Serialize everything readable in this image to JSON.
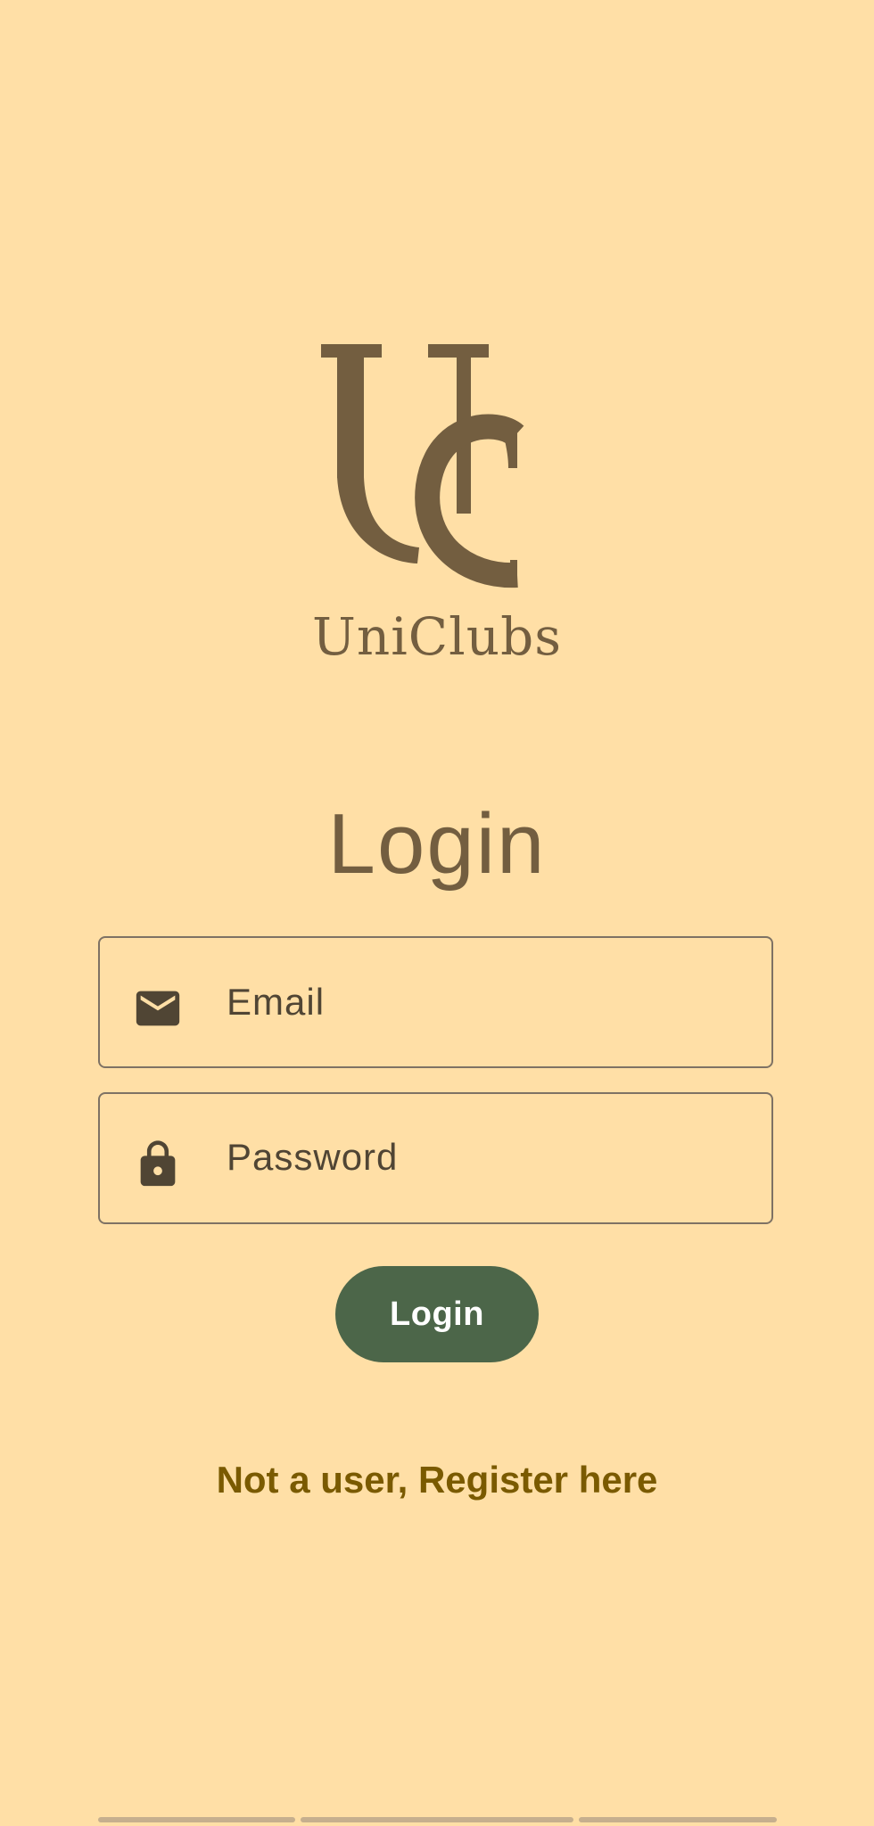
{
  "brand": {
    "name": "UniClubs",
    "logo_icon": "uc-monogram-logo",
    "color": "#735E40"
  },
  "page": {
    "title": "Login",
    "background": "#FFDFA6"
  },
  "form": {
    "email": {
      "placeholder": "Email",
      "icon": "mail-icon"
    },
    "password": {
      "placeholder": "Password",
      "icon": "lock-icon"
    },
    "submit_label": "Login",
    "submit_color": "#4C6649"
  },
  "links": {
    "register": "Not a user, Register here",
    "register_color": "#7A5A00"
  }
}
